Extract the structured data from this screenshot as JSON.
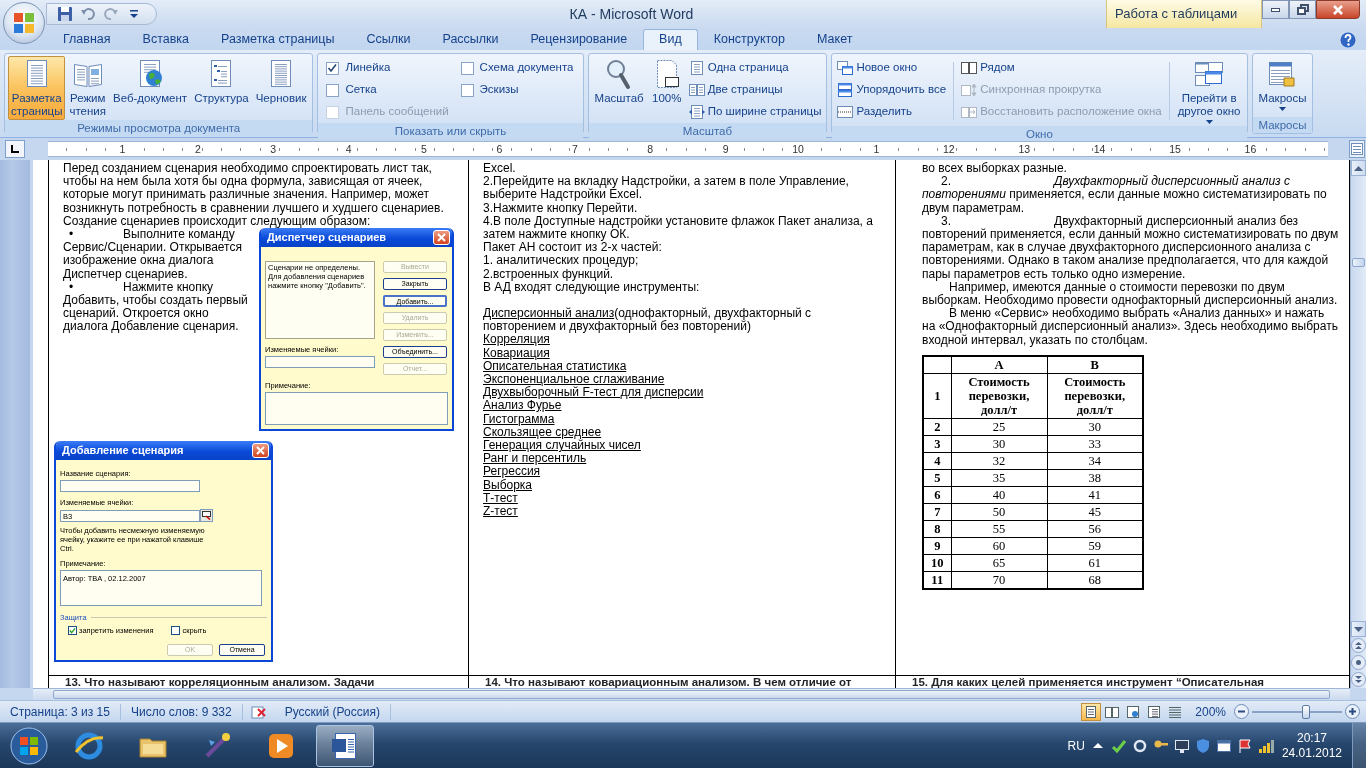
{
  "window": {
    "title": "КА - Microsoft Word",
    "context_group": "Работа с таблицами"
  },
  "ribbon_tabs": [
    {
      "label": "Главная",
      "selected": false
    },
    {
      "label": "Вставка",
      "selected": false
    },
    {
      "label": "Разметка страницы",
      "selected": false
    },
    {
      "label": "Ссылки",
      "selected": false
    },
    {
      "label": "Рассылки",
      "selected": false
    },
    {
      "label": "Рецензирование",
      "selected": false
    },
    {
      "label": "Вид",
      "selected": true
    },
    {
      "label": "Конструктор",
      "selected": false
    },
    {
      "label": "Макет",
      "selected": false
    }
  ],
  "ribbon_groups": [
    {
      "label": "Режимы просмотра документа",
      "columns": [
        {
          "kind": "large",
          "label": "Разметка\nстраницы",
          "selected": true,
          "dropdown": false
        },
        {
          "kind": "large",
          "label": "Режим\nчтения",
          "selected": false,
          "dropdown": false
        },
        {
          "kind": "large",
          "label": "Веб-документ",
          "selected": false,
          "dropdown": false
        },
        {
          "kind": "large",
          "label": "Структура",
          "selected": false,
          "dropdown": false
        },
        {
          "kind": "large",
          "label": "Черновик",
          "selected": false,
          "dropdown": false
        }
      ]
    },
    {
      "label": "Показать или скрыть",
      "columns": [
        {
          "kind": "stack",
          "items": [
            {
              "kind": "check",
              "label": "Линейка",
              "checked": true,
              "disabled": false
            },
            {
              "kind": "check",
              "label": "Сетка",
              "checked": false,
              "disabled": false
            },
            {
              "kind": "check",
              "label": "Панель сообщений",
              "checked": false,
              "disabled": true
            }
          ]
        },
        {
          "kind": "stack",
          "items": [
            {
              "kind": "check",
              "label": "Схема документа",
              "checked": false,
              "disabled": false
            },
            {
              "kind": "check",
              "label": "Эскизы",
              "checked": false,
              "disabled": false
            }
          ]
        }
      ]
    },
    {
      "label": "Масштаб",
      "columns": [
        {
          "kind": "large",
          "label": "Масштаб",
          "selected": false,
          "dropdown": false
        },
        {
          "kind": "large",
          "label": "100%",
          "selected": false,
          "dropdown": false
        },
        {
          "kind": "stack",
          "items": [
            {
              "kind": "command",
              "label": "Одна страница",
              "disabled": false
            },
            {
              "kind": "command",
              "label": "Две страницы",
              "disabled": false
            },
            {
              "kind": "command",
              "label": "По ширине страницы",
              "disabled": false
            }
          ]
        }
      ]
    },
    {
      "label": "Окно",
      "columns": [
        {
          "kind": "stack",
          "items": [
            {
              "kind": "command",
              "label": "Новое окно",
              "disabled": false
            },
            {
              "kind": "command",
              "label": "Упорядочить все",
              "disabled": false
            },
            {
              "kind": "command",
              "label": "Разделить",
              "disabled": false
            }
          ]
        },
        {
          "kind": "separator"
        },
        {
          "kind": "stack",
          "items": [
            {
              "kind": "command",
              "label": "Рядом",
              "disabled": false
            },
            {
              "kind": "command",
              "label": "Синхронная прокрутка",
              "disabled": true
            },
            {
              "kind": "command",
              "label": "Восстановить расположение окна",
              "disabled": true
            }
          ]
        },
        {
          "kind": "separator"
        },
        {
          "kind": "large",
          "label": "Перейти в\nдругое окно",
          "selected": false,
          "dropdown": true
        }
      ]
    },
    {
      "label": "Макросы",
      "columns": [
        {
          "kind": "large",
          "label": "Макросы",
          "selected": false,
          "dropdown": true
        }
      ]
    }
  ],
  "ruler": {
    "numbers": [
      "1",
      "2",
      "3",
      "4",
      "5",
      "6",
      "7",
      "8",
      "9",
      "10",
      "1",
      "12",
      "13",
      "14",
      "15",
      "16"
    ]
  },
  "document": {
    "left": {
      "paragraphs": [
        "Перед созданием сценария необходимо спроектировать лист так, чтобы на нем была хотя бы одна формула, зависящая от ячеек, которые могут принимать  различные значения. Например, может возникнуть потребность в сравнении лучшего и худшего сценариев.",
        "Создание сценариев происходит следующим образом:"
      ],
      "bullets": [
        {
          "marker": "•",
          "text": "Выполните команду Сервис/Сценарии. Открывается изображение окна диалога Диспетчер сценариев."
        },
        {
          "marker": "•",
          "text": "Нажмите кнопку Добавить,  чтобы создать первый сценарий. Откроется окно диалога Добавление сценария."
        }
      ],
      "manager_dialog": {
        "title": "Диспетчер сценариев",
        "message": "Сценарии не определены. Для добавления сценариев нажмите кнопку \"Добавить\".",
        "buttons": [
          {
            "label": "Вывести",
            "disabled": true,
            "focused": false
          },
          {
            "label": "Закрыть",
            "disabled": false,
            "focused": false
          },
          {
            "label": "Добавить...",
            "disabled": false,
            "focused": true
          },
          {
            "label": "Удалить",
            "disabled": true,
            "focused": false
          },
          {
            "label": "Изменить...",
            "disabled": true,
            "focused": false
          },
          {
            "label": "Объединить...",
            "disabled": false,
            "focused": false
          },
          {
            "label": "Отчет...",
            "disabled": true,
            "focused": false
          }
        ],
        "cells_label": "Изменяемые ячейки:",
        "note_label": "Примечание:"
      },
      "add_dialog": {
        "title": "Добавление сценария",
        "name_label": "Название сценария:",
        "cells_label": "Изменяемые ячейки:",
        "cells_value": "B3",
        "hint": "Чтобы добавить несмежную изменяемую ячейку, укажите ее при нажатой клавише Ctrl.",
        "note_label": "Примечание:",
        "note_value": "Автор: TBA , 02.12.2007",
        "protection_label": "Защита",
        "options": [
          {
            "label": "запретить изменения",
            "checked": true
          },
          {
            "label": "скрыть",
            "checked": false
          }
        ],
        "buttons": [
          {
            "label": "OK",
            "disabled": true
          },
          {
            "label": "Отмена",
            "disabled": false
          }
        ]
      }
    },
    "middle": [
      {
        "kind": "text",
        "text": "Excel."
      },
      {
        "kind": "text",
        "text": "2.Перейдите на вкладку Надстройки, а затем в поле Управление, выберите Надстройки  Excel."
      },
      {
        "kind": "text",
        "text": "3.Нажмите кнопку Перейти."
      },
      {
        "kind": "text",
        "text": "4.В поле Доступные надстройки установите флажок Пакет анализа, а затем нажмите кнопку ОК."
      },
      {
        "kind": "text",
        "text": "Пакет АН состоит из 2-х частей:"
      },
      {
        "kind": "text",
        "text": "1. аналитических процедур;"
      },
      {
        "kind": "text",
        "text": "2.встроенных функций."
      },
      {
        "kind": "text",
        "text": "В АД входят следующие инструменты:"
      },
      {
        "kind": "link_text",
        "link": "Дисперсионный анализ",
        "text": "(однофакторный,  двухфакторный с повторением и двухфакторный без повторений)"
      },
      {
        "kind": "link",
        "text": "Корреляция"
      },
      {
        "kind": "link",
        "text": "Ковариация"
      },
      {
        "kind": "link",
        "text": "Описательная статистика"
      },
      {
        "kind": "link",
        "text": "Экспоненциальное сглаживание"
      },
      {
        "kind": "link",
        "text": "Двухвыборочный F-тест для дисперсии"
      },
      {
        "kind": "link",
        "text": "Анализ Фурье"
      },
      {
        "kind": "link",
        "text": "Гистограмма"
      },
      {
        "kind": "link",
        "text": "Скользящее среднее"
      },
      {
        "kind": "link",
        "text": "Генерация случайных чисел"
      },
      {
        "kind": "link",
        "text": "Ранг и персентиль"
      },
      {
        "kind": "link",
        "text": "Регрессия"
      },
      {
        "kind": "link",
        "text": "Выборка"
      },
      {
        "kind": "link",
        "text": "Т-тест"
      },
      {
        "kind": "link",
        "text": "Z-тест"
      }
    ],
    "right": {
      "paragraphs": [
        {
          "kind": "text",
          "text": "во всех выборках разные."
        },
        {
          "kind": "numbered",
          "number": "2.",
          "text": "*Двухфакторный дисперсионный анализ с повторениями* применяется, если данные можно систематизировать по двум параметрам."
        },
        {
          "kind": "numbered",
          "number": "3.",
          "text": "Двухфакторный дисперсионный анализ без повторений применяется, если данный можно систематизировать по двум параметрам, как в случае двухфакторного дисперсионного анализа с повторениями. Однако в таком анализе предполагается, что для каждой пары параметров есть только одно измерение."
        },
        {
          "kind": "indented",
          "text": "Например, имеются данные о стоимости перевозки по двум выборкам. Необходимо провести однофакторный дисперсионный анализ."
        },
        {
          "kind": "indented",
          "text": "В меню «Сервис» необходимо выбрать «Анализ данных» и нажать на «Однофакторный дисперсионный анализ». Здесь необходимо выбрать входной интервал, указать по столбцам."
        }
      ],
      "table": {
        "columns": [
          "A",
          "B"
        ],
        "rows": [
          {
            "label": "1",
            "cells": [
              "Стоимость перевозки, долл/т",
              "Стоимость перевозки, долл/т"
            ]
          },
          {
            "label": "2",
            "cells": [
              "25",
              "30"
            ]
          },
          {
            "label": "3",
            "cells": [
              "30",
              "33"
            ]
          },
          {
            "label": "4",
            "cells": [
              "32",
              "34"
            ]
          },
          {
            "label": "5",
            "cells": [
              "35",
              "38"
            ]
          },
          {
            "label": "6",
            "cells": [
              "40",
              "41"
            ]
          },
          {
            "label": "7",
            "cells": [
              "50",
              "45"
            ]
          },
          {
            "label": "8",
            "cells": [
              "55",
              "56"
            ]
          },
          {
            "label": "9",
            "cells": [
              "60",
              "59"
            ]
          },
          {
            "label": "10",
            "cells": [
              "65",
              "61"
            ]
          },
          {
            "label": "11",
            "cells": [
              "70",
              "68"
            ]
          }
        ]
      }
    },
    "next_row": [
      "13. Что называют корреляционным анализом. Задачи",
      "14. Что называют ковариационным анализом. В чем отличие от",
      "15. Для каких целей применяется инструмент “Описательная"
    ]
  },
  "status_bar": {
    "page": "Страница: 3 из 15",
    "words": "Число слов: 9 332",
    "language": "Русский (Россия)",
    "views": [
      {
        "selected": true
      },
      {
        "selected": false
      },
      {
        "selected": false
      },
      {
        "selected": false
      },
      {
        "selected": false
      }
    ],
    "zoom": "200%",
    "zoom_slider": {
      "level": 0.6
    }
  },
  "taskbar": {
    "apps": [
      {
        "selected": false
      },
      {
        "selected": false
      },
      {
        "selected": false
      },
      {
        "selected": false
      },
      {
        "selected": true
      }
    ],
    "language": "RU",
    "time": "20:17",
    "date": "24.01.2012"
  }
}
